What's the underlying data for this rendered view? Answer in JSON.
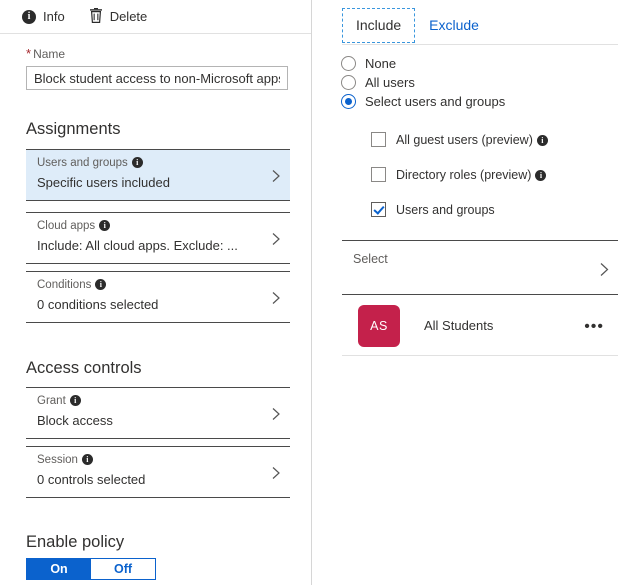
{
  "toolbar": {
    "info_label": "Info",
    "info_icon": "info-circle-icon",
    "delete_label": "Delete",
    "delete_icon": "trash-icon"
  },
  "name_field": {
    "required_marker": "*",
    "label": "Name",
    "value": "Block student access to non-Microsoft apps",
    "placeholder": "Name"
  },
  "assignments": {
    "heading": "Assignments",
    "rows": [
      {
        "title": "Users and groups",
        "value": "Specific users included",
        "has_info": true,
        "highlighted": true
      },
      {
        "title": "Cloud apps",
        "value": "Include: All cloud apps. Exclude: ...",
        "has_info": true,
        "highlighted": false
      },
      {
        "title": "Conditions",
        "value": "0 conditions selected",
        "has_info": true,
        "highlighted": false
      }
    ]
  },
  "access_controls": {
    "heading": "Access controls",
    "rows": [
      {
        "title": "Grant",
        "value": "Block access",
        "has_info": true,
        "highlighted": false
      },
      {
        "title": "Session",
        "value": "0 controls selected",
        "has_info": true,
        "highlighted": false
      }
    ]
  },
  "enable_policy": {
    "heading": "Enable policy",
    "on_label": "On",
    "off_label": "Off",
    "selected": "On"
  },
  "right_panel": {
    "tabs": [
      {
        "label": "Include",
        "selected": true
      },
      {
        "label": "Exclude",
        "selected": false
      }
    ],
    "radios": [
      {
        "label": "None",
        "checked": false
      },
      {
        "label": "All users",
        "checked": false
      },
      {
        "label": "Select users and groups",
        "checked": true
      }
    ],
    "checkboxes": [
      {
        "label": "All guest users (preview)",
        "checked": false,
        "has_info": true
      },
      {
        "label": "Directory roles (preview)",
        "checked": false,
        "has_info": true
      },
      {
        "label": "Users and groups",
        "checked": true,
        "has_info": false
      }
    ],
    "select_row": {
      "label": "Select"
    },
    "group": {
      "initials": "AS",
      "name": "All Students",
      "menu_glyph": "•••",
      "avatar_color": "#c4214b"
    }
  },
  "colors": {
    "accent": "#0b62cd",
    "highlight_row": "#deecf9",
    "required": "#a4262c",
    "avatar": "#c4214b",
    "focus_dash": "#3a96dd"
  }
}
